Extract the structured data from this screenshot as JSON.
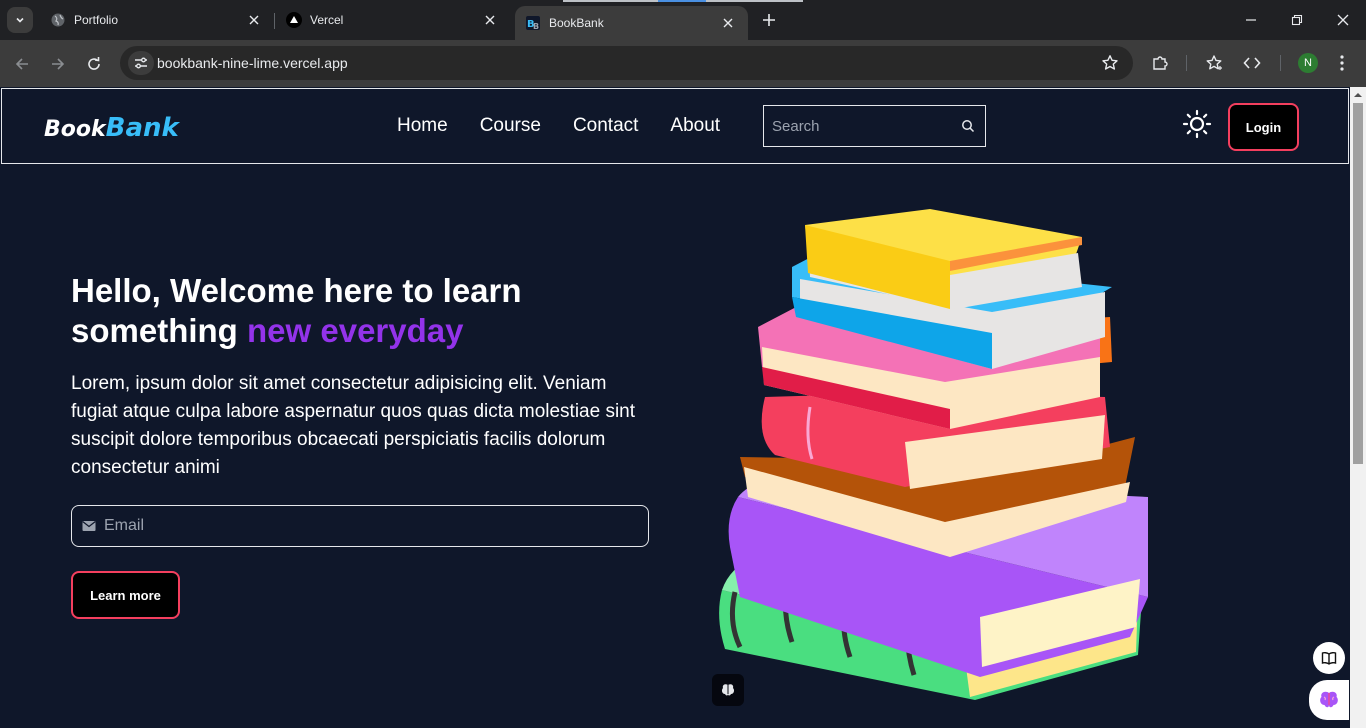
{
  "browser": {
    "tabs": [
      {
        "title": "Portfolio",
        "icon": "globe-icon",
        "active": false
      },
      {
        "title": "Vercel",
        "icon": "vercel-triangle-icon",
        "active": false
      },
      {
        "title": "BookBank",
        "icon": "bookbank-favicon",
        "active": true
      }
    ],
    "url": "bookbank-nine-lime.vercel.app",
    "profile_initial": "N"
  },
  "site": {
    "logo": {
      "part1": "Book",
      "part2": "Bank"
    },
    "nav": [
      "Home",
      "Course",
      "Contact",
      "About"
    ],
    "search_placeholder": "Search",
    "login_label": "Login",
    "hero": {
      "title_line1": "Hello, Welcome here to learn",
      "title_line2_plain": "something ",
      "title_line2_accent": "new everyday",
      "text": "Lorem, ipsum dolor sit amet consectetur adipisicing elit. Veniam fugiat atque culpa labore aspernatur quos quas dicta molestiae sint suscipit dolore temporibus obcaecati perspiciatis facilis dolorum consectetur animi",
      "email_placeholder": "Email",
      "cta_label": "Learn more"
    }
  },
  "colors": {
    "page_bg": "#0f172a",
    "logo_accent": "#38bdf8",
    "title_accent": "#9333ea",
    "button_border": "#f43f5e"
  }
}
